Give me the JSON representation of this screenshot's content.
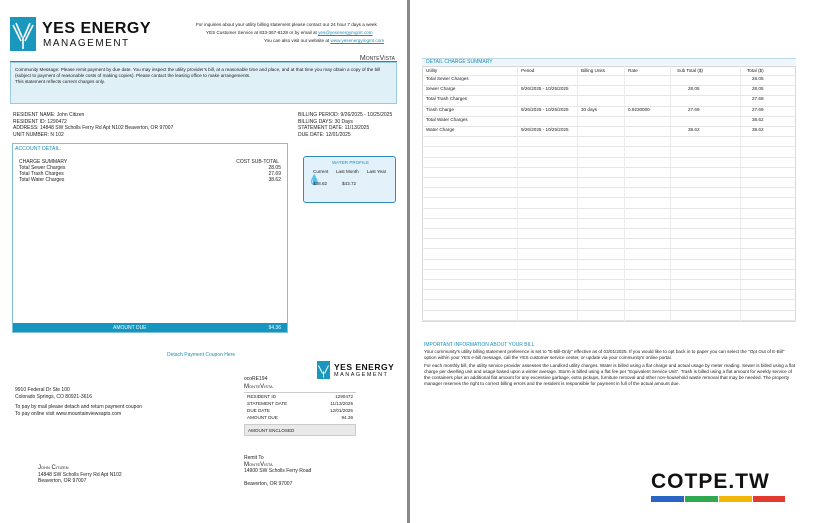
{
  "header": {
    "brand_line1": "YES ENERGY",
    "brand_line2": "MANAGEMENT",
    "inquiry_line": "For inquiries about your utility billing statement please contact our 24 hour 7 days a week",
    "service_line": "YES Customer Service at 833-367-6128 or by  email at",
    "service_email": "yes@yesenergymgmt.com",
    "website_line": "You can also visit our website at",
    "website": "www.yesenergymgmt.com"
  },
  "property_name": "MonteVista",
  "message": {
    "text": "Community Message: Please remit payment by due date. You may inspect the utility provider's bill, at a reasonable time and place, and at that time you may obtain a copy of the bill (subject to payment of reasonable costs of making copies). Please contact the leasing office to make arrangements.",
    "note": "This statement reflects current charges only."
  },
  "resident": {
    "name": "RESIDENT NAME: John Citizen",
    "id": "RESIDENT ID: 1290472",
    "address": "ADDRESS: 14848 SW Scholls Ferry Rd Apt N102 Beaverton, OR 97007",
    "unit": "UNIT NUMBER: N 102"
  },
  "billing": {
    "period": "BILLING PERIOD: 9/26/2025 - 10/25/2025",
    "days": "BILLING DAYS:  30 Days",
    "statement_date": "STATEMENT DATE: 11/13/2025",
    "due_date": "DUE DATE: 12/01/2025"
  },
  "account_detail": {
    "title": "ACCOUNT DETAIL:",
    "summary_label": "CHARGE SUMMARY",
    "subtotal_label": "COST SUB-TOTAL",
    "rows": [
      {
        "label": "Total Sewer Charges",
        "value": "28.05"
      },
      {
        "label": "Total Trash Charges",
        "value": "27.69"
      },
      {
        "label": "Total Water Charges",
        "value": "38.62"
      }
    ],
    "amount_due_label": "AMOUNT DUE",
    "amount_due": "94.36"
  },
  "water_profile": {
    "title": "WATER PROFILE",
    "headers": [
      "Current",
      "Last Month",
      "Last Year"
    ],
    "values": [
      "$38.62",
      "$43.72",
      ""
    ]
  },
  "coupon": {
    "detach": "Detach Payment Coupon Here",
    "remit_address_1": "9910 Federal Dr Ste 100",
    "remit_address_2": "Colorado Springs, CO 80921-3616",
    "pay_mail": "To pay by mail please detach and return payment coupon",
    "pay_online": "To pay online visit www.mountainviewsapts.com",
    "code": "ocoRE194",
    "property": "MonteVista",
    "table": [
      {
        "label": "RESIDENT ID",
        "value": "1290472"
      },
      {
        "label": "STATEMENT DATE",
        "value": "11/13/2025"
      },
      {
        "label": "DUE DATE",
        "value": "12/01/2025"
      },
      {
        "label": "AMOUNT DUE",
        "value": "94.36"
      }
    ],
    "enclosed": "AMOUNT ENCLOSED",
    "resident_name": "John Citizen",
    "resident_addr1": "14848 SW Scholls Ferry Rd Apt N102",
    "resident_addr2": "Beaverton, OR 97007",
    "remit_to": "Remit To",
    "remit_name": "MonteVista",
    "remit_addr1": "14900 SW Scholls Ferry Road",
    "remit_addr2": "Beaverton, OR 97007"
  },
  "detail": {
    "title": "DETAIL CHARGE SUMMARY",
    "headers": [
      "Utility",
      "Period",
      "Billing Units",
      "Rate",
      "Sub Total ($)",
      "Total ($)"
    ],
    "rows": [
      [
        "Total Sewer Charges",
        "",
        "",
        "",
        "",
        "28.05"
      ],
      [
        "Sewer Charge",
        "9/26/2025 - 10/25/2025",
        "",
        "",
        "28.05",
        "28.05"
      ],
      [
        "Total Trash Charges",
        "",
        "",
        "",
        "",
        "27.69"
      ],
      [
        "Trash Charge",
        "9/26/2025 - 10/25/2025",
        "30 days",
        "0.9230000",
        "27.69",
        "27.69"
      ],
      [
        "Total Water Charges",
        "",
        "",
        "",
        "",
        "38.62"
      ],
      [
        "Water Charge",
        "9/26/2025 - 10/25/2025",
        "",
        "",
        "38.62",
        "38.62"
      ]
    ]
  },
  "important": {
    "title": "IMPORTANT INFORMATION ABOUT YOUR BILL",
    "para1": "Your community's utility billing statement preference is set to \"E-Bill-Only\" effective as of 03/01/2025. If you would like to opt back in to paper you can select the \"Opt Out of E-Bill\" option within your YES e-bill message, call the YES customer service center, or update via your community's online portal.",
    "para2": "For each monthly bill, the utility service provider assesses  the Landlord utility charges. Water is billed using a flat charge and actual usage by meter reading. Sewer is billed using a flat charge per dwelling unit and usage based upon a winter average. Storm is billed using a flat fee per \"Equivalent Service Unit\". Trash is billed using a flat amount for weekly service of the containers plus an additional flat amount for any excessive garbage, extra pickups, furniture removal and other non-household waste removal that may be needed. The property manager reserves the right to correct billing errors and the resident is responsible for payment in full of the actual amount due."
  },
  "watermark": "COTPE.TW",
  "colors": {
    "accent": "#1b8fb8",
    "bar": "#1496bf",
    "water_border": "#2f8ac0"
  }
}
